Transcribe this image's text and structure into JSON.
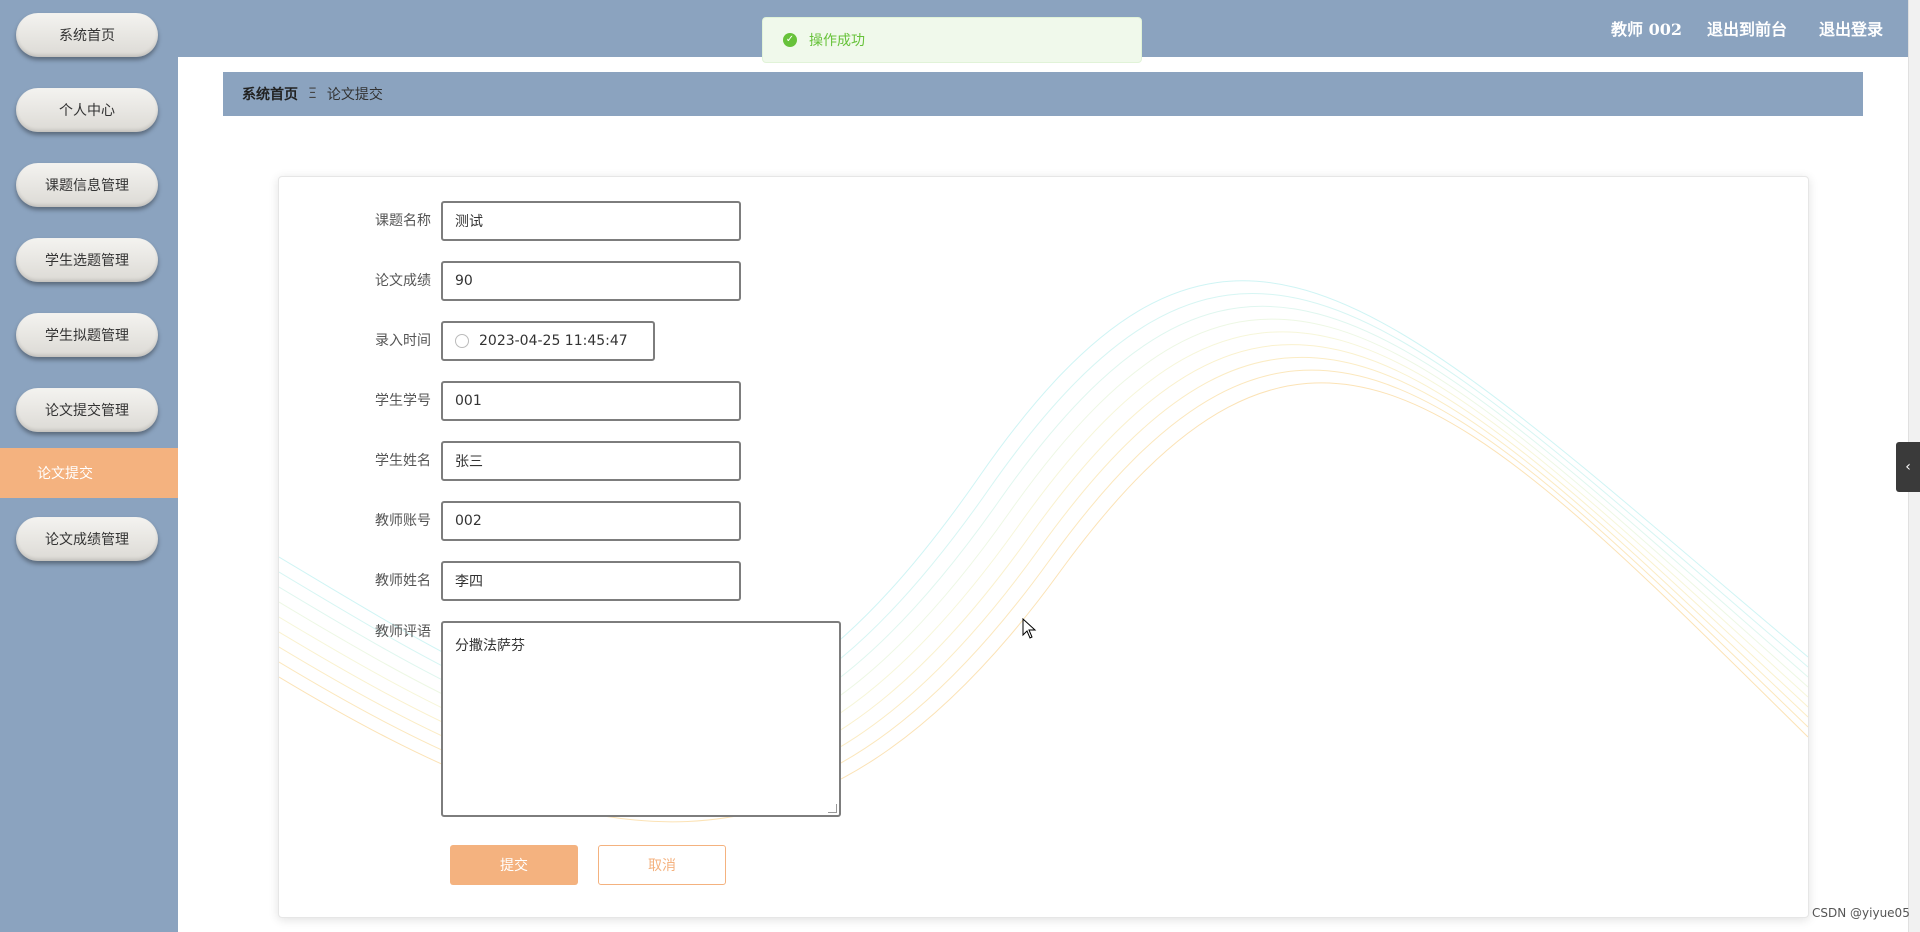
{
  "sidebar": {
    "items": [
      {
        "label": "系统首页"
      },
      {
        "label": "个人中心"
      },
      {
        "label": "课题信息管理"
      },
      {
        "label": "学生选题管理"
      },
      {
        "label": "学生拟题管理"
      },
      {
        "label": "论文提交管理"
      },
      {
        "label": "论文提交",
        "active": true
      },
      {
        "label": "论文成绩管理"
      }
    ]
  },
  "header": {
    "user": "教师 002",
    "back_to_front": "退出到前台",
    "logout": "退出登录"
  },
  "toast": {
    "text": "操作成功",
    "icon": "check-circle-icon",
    "color": "#67c23a"
  },
  "breadcrumb": {
    "home": "系统首页",
    "separator": "Ξ",
    "current": "论文提交"
  },
  "form": {
    "fields": [
      {
        "label": "课题名称",
        "value": "测试"
      },
      {
        "label": "论文成绩",
        "value": "90"
      },
      {
        "label": "录入时间",
        "value": "2023-04-25 11:45:47"
      },
      {
        "label": "学生学号",
        "value": "001"
      },
      {
        "label": "学生姓名",
        "value": "张三"
      },
      {
        "label": "教师账号",
        "value": "002"
      },
      {
        "label": "教师姓名",
        "value": "李四"
      },
      {
        "label": "教师评语",
        "value": "分撒法萨芬"
      }
    ],
    "submit_label": "提交",
    "cancel_label": "取消"
  },
  "side_tab": {
    "icon": "chevron-left-icon",
    "glyph": "‹"
  },
  "watermark": "CSDN @yiyue05",
  "colors": {
    "accent": "#f4b27f",
    "nav": "#8ba3bf"
  }
}
